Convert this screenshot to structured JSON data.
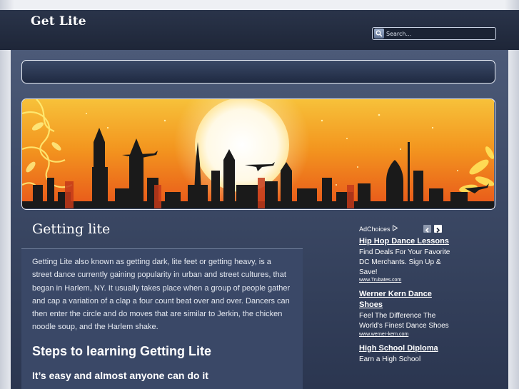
{
  "site": {
    "title": "Get Lite"
  },
  "search": {
    "placeholder": "Search..."
  },
  "page": {
    "title": "Getting lite",
    "body": "Getting Lite also known as getting dark, lite feet or getting heavy, is a street dance currently gaining popularity in urban and street cultures, that began in Harlem, NY. It usually takes place when a group of people gather and cap a variation of a clap a four count beat over and over. Dancers can then enter the circle and do moves that are similar to Jerkin, the chicken noodle soup, and the Harlem shake.",
    "section_heading": "Steps to learning Getting Lite",
    "sub_heading": "It’s easy and almost anyone can do it"
  },
  "ads": {
    "label": "AdChoices",
    "items": [
      {
        "title": "Hip Hop Dance Lessons",
        "desc": "Find Deals For Your Favorite DC Merchants. Sign Up & Save!",
        "url": "www.Trubates.com"
      },
      {
        "title": "Werner Kern Dance Shoes",
        "desc": "Feel The Difference The World's Finest Dance Shoes",
        "url": "www.werner-kern.com"
      },
      {
        "title": "High School Diploma",
        "desc": "Earn a High School",
        "url": ""
      }
    ]
  },
  "icons": {
    "search": "search-icon",
    "adchoices": "adchoices-icon",
    "prev": "chevron-left-icon",
    "next": "chevron-right-icon"
  },
  "colors": {
    "header_bg": "#1e2638",
    "content_bg": "#3a4763",
    "banner_orange": "#f07a1a"
  }
}
